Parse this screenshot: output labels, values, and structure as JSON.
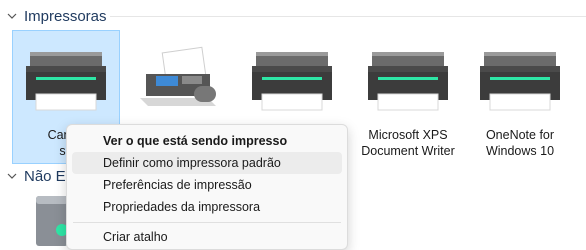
{
  "sections": {
    "printers_title": "Impressoras",
    "other_title": "Não Es"
  },
  "devices": [
    {
      "line1": "Canon",
      "line2": "se"
    },
    {
      "line1": "",
      "line2": ""
    },
    {
      "line1": "",
      "line2": ""
    },
    {
      "line1": "Microsoft XPS",
      "line2": "Document Writer"
    },
    {
      "line1": "OneNote for",
      "line2": "Windows 10"
    }
  ],
  "menu": {
    "items": [
      "Ver o que está sendo impresso",
      "Definir como impressora padrão",
      "Preferências de impressão",
      "Propriedades da impressora",
      "Criar atalho"
    ]
  },
  "colors": {
    "selected_tile": "#cde8ff",
    "printer_led": "#2ee6a6"
  }
}
